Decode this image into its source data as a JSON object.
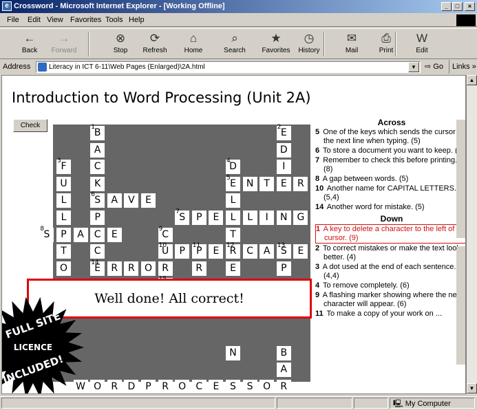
{
  "window": {
    "title": "Crossword - Microsoft Internet Explorer - [Working Offline]",
    "controls": [
      "_",
      "□",
      "×"
    ]
  },
  "menu": [
    "File",
    "Edit",
    "View",
    "Favorites",
    "Tools",
    "Help"
  ],
  "toolbar": [
    {
      "label": "Back",
      "icon": "←",
      "enabled": true
    },
    {
      "label": "Forward",
      "icon": "→",
      "enabled": false
    },
    {
      "label": "Stop",
      "icon": "⊗",
      "enabled": true
    },
    {
      "label": "Refresh",
      "icon": "⟳",
      "enabled": true
    },
    {
      "label": "Home",
      "icon": "⌂",
      "enabled": true
    },
    {
      "label": "Search",
      "icon": "⌕",
      "enabled": true
    },
    {
      "label": "Favorites",
      "icon": "★",
      "enabled": true
    },
    {
      "label": "History",
      "icon": "◷",
      "enabled": true
    },
    {
      "label": "Mail",
      "icon": "✉",
      "enabled": true
    },
    {
      "label": "Print",
      "icon": "⎙",
      "enabled": true
    },
    {
      "label": "Edit",
      "icon": "W",
      "enabled": true
    }
  ],
  "address": {
    "label": "Address",
    "value": "Literacy in ICT 6-11\\Web Pages (Enlarged)\\2A.html",
    "go": "Go",
    "links": "Links"
  },
  "page": {
    "title": "Introduction to Word Processing (Unit 2A)",
    "check_label": "Check",
    "done_message": "Well done!  All correct!"
  },
  "crossword": {
    "cells": [
      {
        "r": 0,
        "c": 2,
        "l": "B",
        "n": "1"
      },
      {
        "r": 0,
        "c": 13,
        "l": "E",
        "n": "2"
      },
      {
        "r": 1,
        "c": 2,
        "l": "A"
      },
      {
        "r": 1,
        "c": 13,
        "l": "D"
      },
      {
        "r": 2,
        "c": 0,
        "l": "F",
        "n": "3"
      },
      {
        "r": 2,
        "c": 2,
        "l": "C"
      },
      {
        "r": 2,
        "c": 10,
        "l": "D",
        "n": "4"
      },
      {
        "r": 2,
        "c": 13,
        "l": "I"
      },
      {
        "r": 3,
        "c": 0,
        "l": "U"
      },
      {
        "r": 3,
        "c": 2,
        "l": "K"
      },
      {
        "r": 3,
        "c": 10,
        "l": "E",
        "n": "5"
      },
      {
        "r": 3,
        "c": 11,
        "l": "N"
      },
      {
        "r": 3,
        "c": 12,
        "l": "T"
      },
      {
        "r": 3,
        "c": 13,
        "l": "E"
      },
      {
        "r": 3,
        "c": 14,
        "l": "R"
      },
      {
        "r": 4,
        "c": 0,
        "l": "L"
      },
      {
        "r": 4,
        "c": 2,
        "l": "S",
        "n": "6"
      },
      {
        "r": 4,
        "c": 3,
        "l": "A"
      },
      {
        "r": 4,
        "c": 4,
        "l": "V"
      },
      {
        "r": 4,
        "c": 5,
        "l": "E"
      },
      {
        "r": 4,
        "c": 10,
        "l": "L"
      },
      {
        "r": 5,
        "c": 0,
        "l": "L"
      },
      {
        "r": 5,
        "c": 2,
        "l": "P"
      },
      {
        "r": 5,
        "c": 7,
        "l": "S",
        "n": "7"
      },
      {
        "r": 5,
        "c": 8,
        "l": "P"
      },
      {
        "r": 5,
        "c": 9,
        "l": "E"
      },
      {
        "r": 5,
        "c": 10,
        "l": "L"
      },
      {
        "r": 5,
        "c": 11,
        "l": "L"
      },
      {
        "r": 5,
        "c": 12,
        "l": "I"
      },
      {
        "r": 5,
        "c": 13,
        "l": "N"
      },
      {
        "r": 5,
        "c": 14,
        "l": "G"
      },
      {
        "r": 6,
        "c": -1,
        "l": "S",
        "n": "8"
      },
      {
        "r": 6,
        "c": 0,
        "l": "P"
      },
      {
        "r": 6,
        "c": 1,
        "l": "A"
      },
      {
        "r": 6,
        "c": 2,
        "l": "C"
      },
      {
        "r": 6,
        "c": 3,
        "l": "E"
      },
      {
        "r": 6,
        "c": 6,
        "l": "C",
        "n": "9"
      },
      {
        "r": 6,
        "c": 10,
        "l": "T"
      },
      {
        "r": 7,
        "c": 0,
        "l": "T"
      },
      {
        "r": 7,
        "c": 2,
        "l": "C"
      },
      {
        "r": 7,
        "c": 6,
        "l": "U",
        "n": "10"
      },
      {
        "r": 7,
        "c": 7,
        "l": "P"
      },
      {
        "r": 7,
        "c": 8,
        "l": "P",
        "n": "11"
      },
      {
        "r": 7,
        "c": 9,
        "l": "E"
      },
      {
        "r": 7,
        "c": 10,
        "l": "R",
        "n": "12"
      },
      {
        "r": 7,
        "c": 11,
        "l": "C"
      },
      {
        "r": 7,
        "c": 12,
        "l": "A"
      },
      {
        "r": 7,
        "c": 13,
        "l": "S",
        "n": "13"
      },
      {
        "r": 7,
        "c": 14,
        "l": "E"
      },
      {
        "r": 8,
        "c": 0,
        "l": "O"
      },
      {
        "r": 8,
        "c": 2,
        "l": "E",
        "n": "14"
      },
      {
        "r": 8,
        "c": 3,
        "l": "R"
      },
      {
        "r": 8,
        "c": 4,
        "l": "R"
      },
      {
        "r": 8,
        "c": 5,
        "l": "O"
      },
      {
        "r": 8,
        "c": 6,
        "l": "R"
      },
      {
        "r": 8,
        "c": 8,
        "l": "R"
      },
      {
        "r": 8,
        "c": 10,
        "l": "E"
      },
      {
        "r": 8,
        "c": 13,
        "l": "P"
      },
      {
        "r": 9,
        "c": 6,
        "l": "",
        "n": "15"
      },
      {
        "r": 13,
        "c": 10,
        "l": "N"
      },
      {
        "r": 13,
        "c": 13,
        "l": "B"
      },
      {
        "r": 14,
        "c": 13,
        "l": "A"
      },
      {
        "r": 15,
        "c": 1,
        "l": "W"
      },
      {
        "r": 15,
        "c": 2,
        "l": "O"
      },
      {
        "r": 15,
        "c": 3,
        "l": "R"
      },
      {
        "r": 15,
        "c": 4,
        "l": "D"
      },
      {
        "r": 15,
        "c": 5,
        "l": "P"
      },
      {
        "r": 15,
        "c": 6,
        "l": "R"
      },
      {
        "r": 15,
        "c": 7,
        "l": "O"
      },
      {
        "r": 15,
        "c": 8,
        "l": "C"
      },
      {
        "r": 15,
        "c": 9,
        "l": "E"
      },
      {
        "r": 15,
        "c": 10,
        "l": "S"
      },
      {
        "r": 15,
        "c": 11,
        "l": "S"
      },
      {
        "r": 15,
        "c": 12,
        "l": "O"
      },
      {
        "r": 15,
        "c": 13,
        "l": "R"
      }
    ]
  },
  "clues": {
    "across_heading": "Across",
    "across": [
      {
        "n": "5",
        "t": "One of the keys which sends the cursor to the next line when typing. (5)"
      },
      {
        "n": "6",
        "t": "To store a document you want to keep. (4)"
      },
      {
        "n": "7",
        "t": "Remember to check this before printing. (8)"
      },
      {
        "n": "8",
        "t": "A gap between words. (5)"
      },
      {
        "n": "10",
        "t": "Another name for CAPITAL LETTERS. (5,4)"
      },
      {
        "n": "14",
        "t": "Another word for mistake. (5)"
      }
    ],
    "down_heading": "Down",
    "down": [
      {
        "n": "1",
        "t": "A key to delete a character to the left of the cursor. (9)",
        "selected": true
      },
      {
        "n": "2",
        "t": "To correct mistakes or make the text look better. (4)"
      },
      {
        "n": "3",
        "t": "A dot used at the end of each sentence. (4,4)"
      },
      {
        "n": "4",
        "t": "To remove completely. (6)"
      },
      {
        "n": "9",
        "t": "A flashing marker showing where the next character will appear. (6)"
      },
      {
        "n": "11",
        "t": "To make a copy of your work on ..."
      }
    ]
  },
  "badge": {
    "lines": [
      "FULL SITE",
      "LICENCE",
      "INCLUDED!"
    ],
    "color": "#000000"
  },
  "status": {
    "zone": "My Computer"
  }
}
